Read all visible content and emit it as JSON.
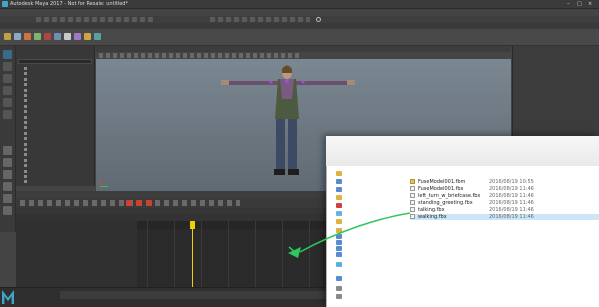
{
  "app": {
    "title": "Autodesk Maya 2017 - Not for Resale: untitled*"
  },
  "menubar": {
    "items": [
      "",
      "",
      "",
      "",
      "",
      "",
      "",
      "",
      "",
      "",
      "",
      "",
      "",
      "",
      "",
      "",
      "",
      "",
      "",
      "",
      ""
    ]
  },
  "statusline": {
    "mode": "",
    "scene_label": "",
    "workspace_label": "",
    "workspace_value": ""
  },
  "shelf": {
    "tabs": [
      "",
      "",
      "",
      "",
      "",
      "",
      "",
      "",
      "",
      "",
      "",
      "",
      "",
      "",
      "",
      ""
    ],
    "active_tab": ""
  },
  "outliner": {
    "title": "",
    "menus": [
      "",
      "",
      ""
    ],
    "items": [
      "",
      "",
      "",
      "",
      "",
      "",
      "",
      "",
      "",
      "",
      "",
      "",
      "",
      "",
      "",
      "",
      "",
      "",
      "",
      "",
      "",
      ""
    ]
  },
  "viewport": {
    "menus": [
      "",
      "",
      "",
      "",
      "",
      ""
    ],
    "color_space": ""
  },
  "rightpanel": {
    "menus": [
      "",
      "",
      "",
      "",
      ""
    ]
  },
  "time_editor": {
    "menus": [
      "",
      "",
      "",
      "",
      "",
      "",
      "",
      "",
      "",
      "",
      "",
      ""
    ],
    "title": "",
    "columns": [
      "",
      "",
      ""
    ],
    "composition": "",
    "ruler_ticks": [
      "",
      "",
      "",
      "",
      "",
      "",
      "",
      "",
      "",
      "",
      "",
      "",
      "",
      ""
    ],
    "current_frame": "",
    "drop_hint": ""
  },
  "time_slider": {
    "start": "",
    "end": "",
    "current": ""
  },
  "explorer": {
    "nav_items": [
      "",
      "",
      "",
      "",
      "",
      "",
      "",
      "",
      "",
      "",
      "",
      "",
      "",
      "",
      "",
      ""
    ],
    "columns": {
      "name": "",
      "date": "",
      "type": "",
      "size": ""
    },
    "files": [
      {
        "name": "FuseModel001.fbm",
        "date": "2016/08/19 10:55",
        "type": "",
        "size": ""
      },
      {
        "name": "FuseModel001.fbx",
        "date": "2016/08/19 11:46",
        "type": "",
        "size": ""
      },
      {
        "name": "left_turn_w_briefcase.fbx",
        "date": "2016/08/19 11:46",
        "type": "",
        "size": ""
      },
      {
        "name": "standing_greeting.fbx",
        "date": "2016/08/19 11:46",
        "type": "",
        "size": ""
      },
      {
        "name": "talking.fbx",
        "date": "2016/08/19 11:46",
        "type": "",
        "size": ""
      },
      {
        "name": "walking.fbx",
        "date": "2016/08/19 11:46",
        "type": "",
        "size": ""
      }
    ]
  },
  "colors": {
    "maya_accent": "#3fa6c8",
    "playhead": "#f0d000",
    "drag_arrow": "#2ec75b",
    "selection": "#cde6f7"
  }
}
